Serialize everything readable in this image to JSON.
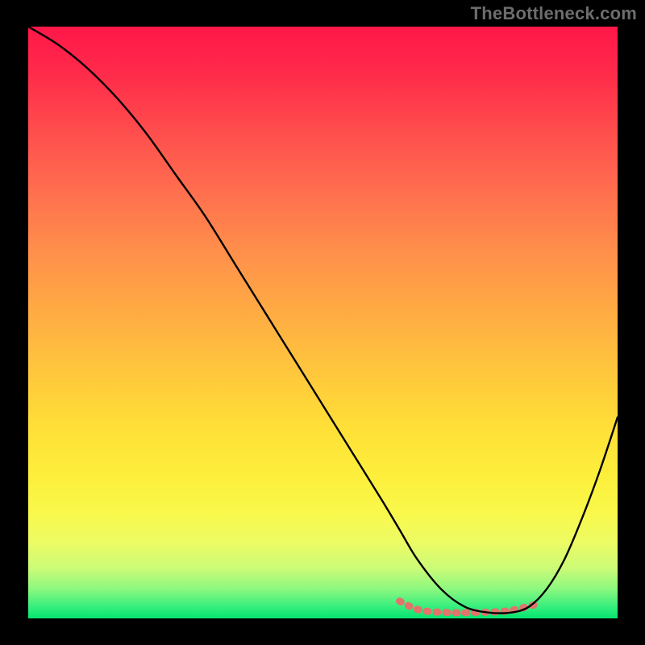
{
  "watermark": "TheBottleneck.com",
  "colors": {
    "black": "#000000",
    "band": "#e2746c"
  },
  "chart_data": {
    "type": "line",
    "title": "",
    "xlabel": "",
    "ylabel": "",
    "xlim": [
      0,
      100
    ],
    "ylim": [
      0,
      100
    ],
    "grid": false,
    "legend": false,
    "series": [
      {
        "name": "curve",
        "x": [
          0,
          5,
          10,
          15,
          20,
          25,
          30,
          35,
          40,
          45,
          50,
          55,
          60,
          63,
          66,
          70,
          74,
          78,
          82,
          85,
          88,
          91,
          94,
          97,
          100
        ],
        "y": [
          100,
          97,
          93,
          88,
          82,
          75,
          68,
          60,
          52,
          44,
          36,
          28,
          20,
          15,
          10,
          5,
          2,
          1,
          1,
          2,
          5,
          10,
          17,
          25,
          34
        ]
      }
    ],
    "optimal_band": {
      "x_start": 63,
      "x_end": 86,
      "y": 1,
      "color": "#e2746c"
    }
  }
}
